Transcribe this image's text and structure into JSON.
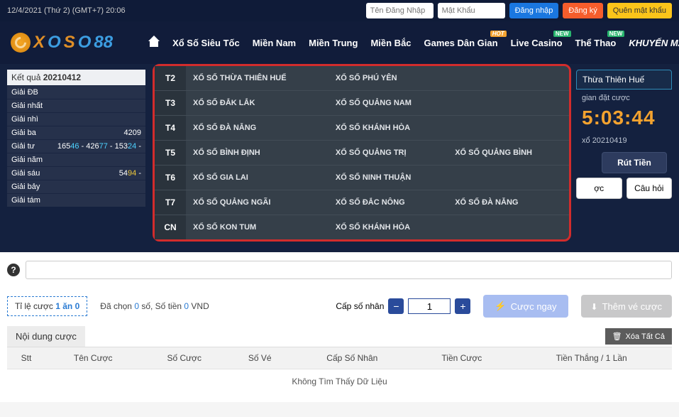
{
  "topbar": {
    "datetime": "12/4/2021 (Thứ 2)   (GMT+7)   20:06",
    "username_ph": "Tên Đăng Nhập",
    "password_ph": "Mật Khẩu",
    "login": "Đăng nhập",
    "register": "Đăng ký",
    "forgot": "Quên mật khẩu"
  },
  "logo": {
    "x1": "X",
    "o1": "O",
    "s": "S",
    "o2": "O",
    "eight": "88"
  },
  "nav": {
    "items": [
      "Xổ Số Siêu Tốc",
      "Miền Nam",
      "Miền Trung",
      "Miền Bắc",
      "Games Dân Gian",
      "Live Casino",
      "Thể Thao",
      "KHUYẾN MÃI"
    ],
    "hot": "HOT",
    "new": "NEW"
  },
  "results": {
    "header_prefix": "Kết quả",
    "header_code": "20210412",
    "rows": [
      {
        "label": "Giải ĐB",
        "val": ""
      },
      {
        "label": "Giải nhất",
        "val": ""
      },
      {
        "label": "Giải nhì",
        "val": ""
      },
      {
        "label": "Giải ba",
        "val": "4209"
      },
      {
        "label": "Giải tư",
        "val_html": true
      },
      {
        "label": "Giải năm",
        "val": ""
      },
      {
        "label": "Giải sáu",
        "val": "5494 -"
      },
      {
        "label": "Giải bảy",
        "val": ""
      },
      {
        "label": "Giải tám",
        "val": ""
      }
    ],
    "g4": {
      "a": "165",
      "a_hl": "46",
      "b": " - 426",
      "b_hl": "77",
      "c": " - 153",
      "c_hl": "24",
      "d": " -"
    }
  },
  "dropdown": {
    "rows": [
      {
        "day": "T2",
        "c1": "XỔ SỐ THỪA THIÊN HUẾ",
        "c2": "XỔ SỐ PHÚ YÊN",
        "c3": ""
      },
      {
        "day": "T3",
        "c1": "XỔ SỐ ĐẮK LẮK",
        "c2": "XỔ SỐ QUẢNG NAM",
        "c3": ""
      },
      {
        "day": "T4",
        "c1": "XỔ SỐ ĐÀ NẴNG",
        "c2": "XỔ SỐ KHÁNH HÒA",
        "c3": ""
      },
      {
        "day": "T5",
        "c1": "XỔ SỐ BÌNH ĐỊNH",
        "c2": "XỔ SỐ QUẢNG TRỊ",
        "c3": "XỔ SỐ QUẢNG BÌNH"
      },
      {
        "day": "T6",
        "c1": "XỔ SỐ GIA LAI",
        "c2": "XỔ SỐ NINH THUẬN",
        "c3": ""
      },
      {
        "day": "T7",
        "c1": "XỔ SỐ QUẢNG NGÃI",
        "c2": "XỔ SỐ ĐẮC NÔNG",
        "c3": "XỔ SỐ ĐÀ NẴNG"
      },
      {
        "day": "CN",
        "c1": "XỔ SỐ KON TUM",
        "c2": "XỔ SỐ KHÁNH HÒA",
        "c3": ""
      }
    ]
  },
  "right": {
    "title": "Thừa Thiên Huế",
    "sub": "gian đặt cược",
    "timer": "5:03:44",
    "code_prefix": "xổ",
    "code": "20210419",
    "withdraw": "Rút Tiền",
    "b1": "ợc",
    "b2": "Câu hỏi"
  },
  "help": {
    "icon": "?"
  },
  "ctrl": {
    "rate_a": "Tỉ lệ cược ",
    "rate_b": "1 ăn 0",
    "chosen_a": "Đã chọn ",
    "chosen_b": "0",
    "chosen_c": " số,   Số tiền ",
    "chosen_d": "0",
    "chosen_e": " VND",
    "mult_label": "Cấp số nhân",
    "mult_val": "1",
    "bet": "Cược ngay",
    "add": "Thêm vé cược"
  },
  "content": {
    "tab": "Nội dung cược",
    "clear": "Xóa Tất Cả",
    "cols": [
      "Stt",
      "Tên Cược",
      "Số Cược",
      "Số Vé",
      "Cấp Số Nhân",
      "Tiền Cược",
      "Tiền Thắng / 1 Lần"
    ],
    "empty": "Không Tìm Thấy Dữ Liệu"
  }
}
